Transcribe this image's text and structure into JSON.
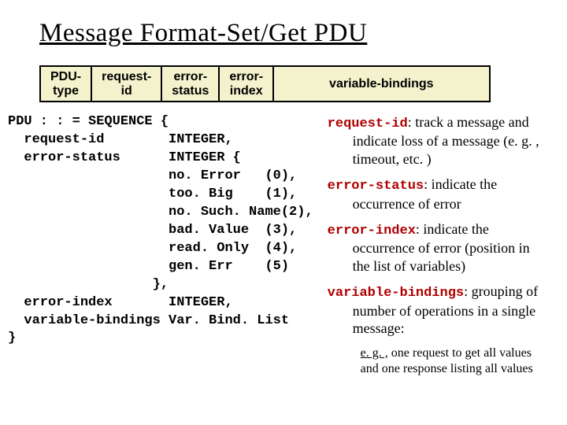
{
  "slide": {
    "title": "Message Format-Set/Get PDU"
  },
  "pdu_header": {
    "col0_l1": "PDU-",
    "col0_l2": "type",
    "col1_l1": "request-",
    "col1_l2": "id",
    "col2_l1": "error-",
    "col2_l2": "status",
    "col3_l1": "error-",
    "col3_l2": "index",
    "col4": "variable-bindings"
  },
  "asn": {
    "code": "PDU : : = SEQUENCE {\n  request-id        INTEGER,\n  error-status      INTEGER {\n                    no. Error   (0),\n                    too. Big    (1),\n                    no. Such. Name(2),\n                    bad. Value  (3),\n                    read. Only  (4),\n                    gen. Err    (5)\n                  },\n  error-index       INTEGER,\n  variable-bindings Var. Bind. List\n}"
  },
  "desc": {
    "i0": {
      "kw": "request-id",
      "text": ": track a message and indicate loss of a message (e. g. , timeout, etc. )"
    },
    "i1": {
      "kw": "error-status",
      "text": ": indicate the occurrence of error"
    },
    "i2": {
      "kw": "error-index",
      "text": ": indicate the occurrence of error (position in the list of variables)"
    },
    "i3": {
      "kw": "variable-bindings",
      "text": ": grouping of number of operations in a single message:"
    },
    "sub_lead": "e. g. ,",
    "sub_rest": " one request to get all values and one response listing all values"
  }
}
